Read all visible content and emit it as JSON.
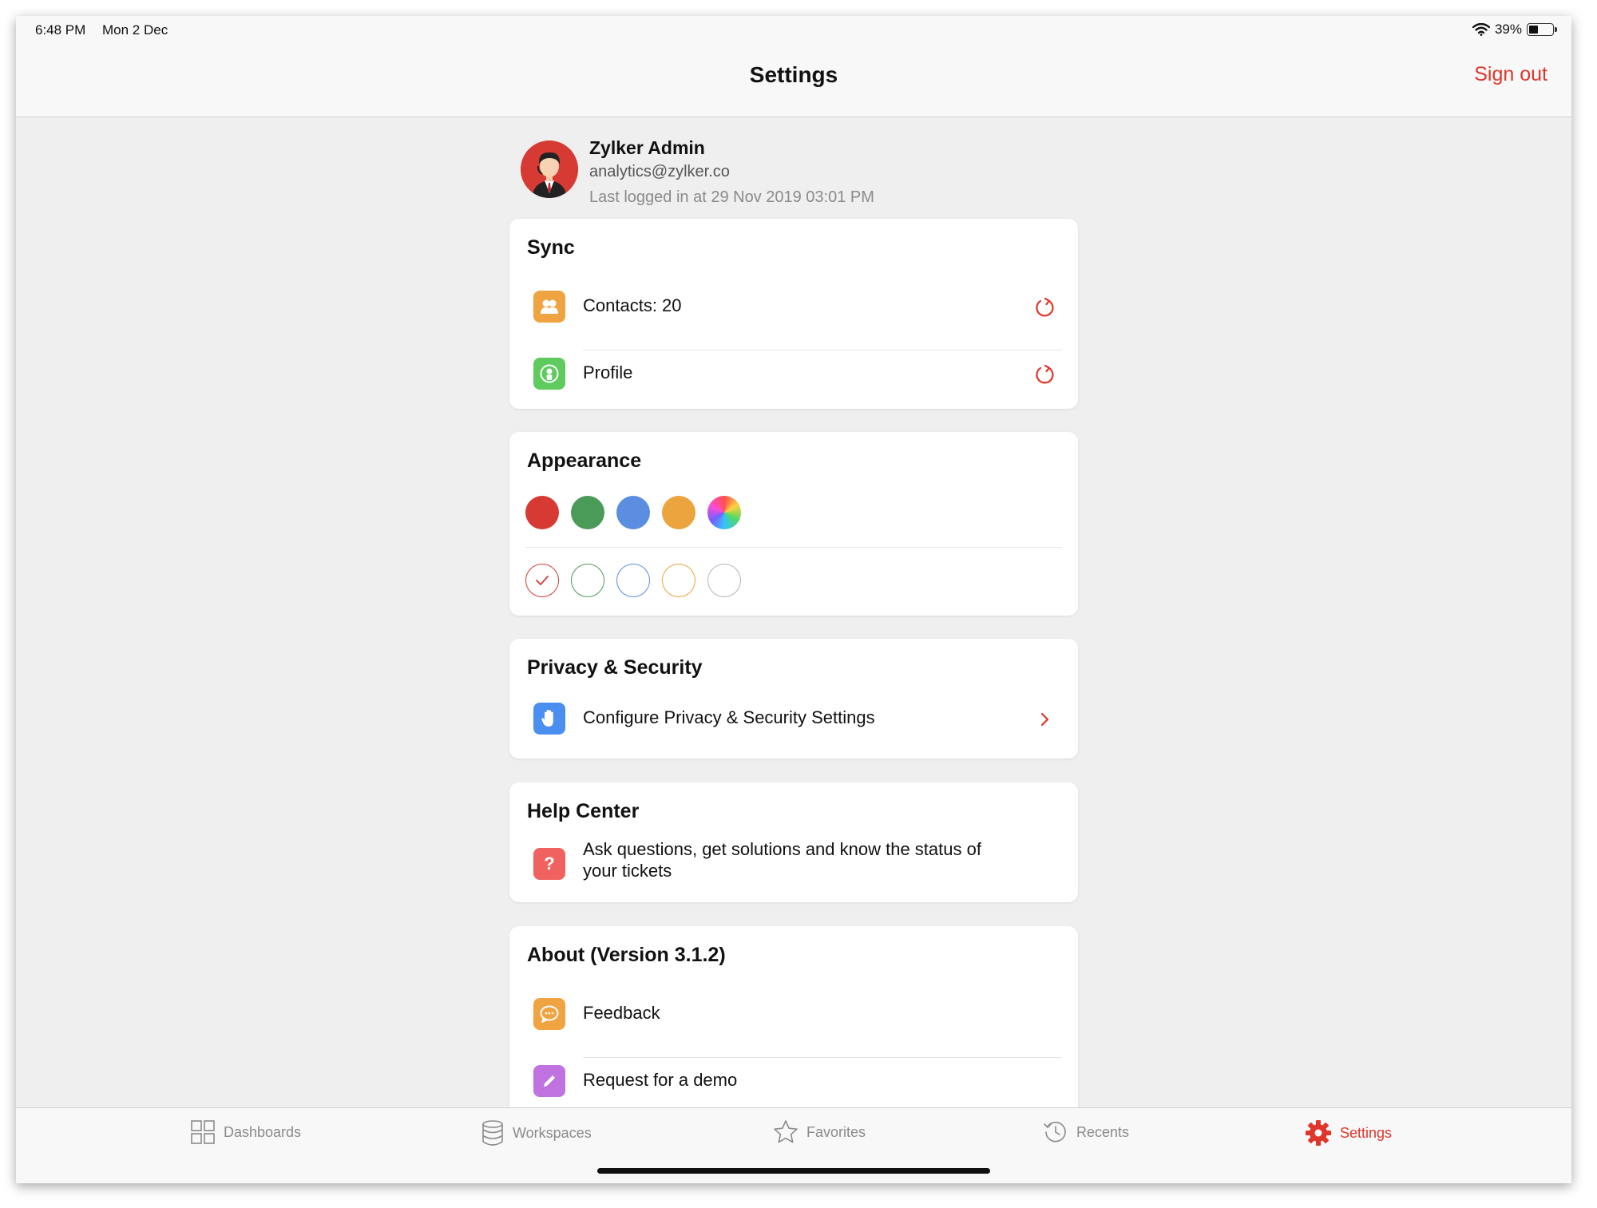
{
  "status_bar": {
    "time": "6:48 PM",
    "date": "Mon 2 Dec",
    "battery": "39%"
  },
  "navbar": {
    "title": "Settings",
    "sign_out": "Sign out"
  },
  "profile": {
    "name": "Zylker Admin",
    "email": "analytics@zylker.co",
    "last_login": "Last logged in at 29 Nov 2019 03:01 PM"
  },
  "sync": {
    "title": "Sync",
    "items": [
      {
        "label": "Contacts: 20",
        "icon": "contacts-icon",
        "color": "#f0a441"
      },
      {
        "label": "Profile",
        "icon": "profile-icon",
        "color": "#5fcb5f"
      }
    ]
  },
  "appearance": {
    "title": "Appearance",
    "theme_colors": [
      "#d63a32",
      "#4a9a58",
      "#5b8ee0",
      "#eca43e",
      "rainbow"
    ],
    "outline_colors": [
      "#d63a32",
      "#4a9a58",
      "#5b8ee0",
      "#eca43e",
      "#b5b5b5"
    ],
    "selected_outline": 0
  },
  "privacy": {
    "title": "Privacy & Security",
    "item": "Configure Privacy & Security Settings",
    "icon_color": "#4a8ef0"
  },
  "help": {
    "title": "Help Center",
    "line1": "Ask questions, get solutions and know the status of",
    "line2": "your tickets",
    "icon_color": "#f06260"
  },
  "about": {
    "title": "About (Version 3.1.2)",
    "items": [
      {
        "label": "Feedback",
        "color": "#f0a441"
      },
      {
        "label": "Request for a demo",
        "color": "#c072e0"
      }
    ]
  },
  "tabs": [
    {
      "label": "Dashboards",
      "icon": "dashboards-icon"
    },
    {
      "label": "Workspaces",
      "icon": "workspaces-icon"
    },
    {
      "label": "Favorites",
      "icon": "favorites-icon"
    },
    {
      "label": "Recents",
      "icon": "recents-icon"
    },
    {
      "label": "Settings",
      "icon": "settings-gear-icon",
      "active": true
    }
  ],
  "accent_color": "#e0352b"
}
